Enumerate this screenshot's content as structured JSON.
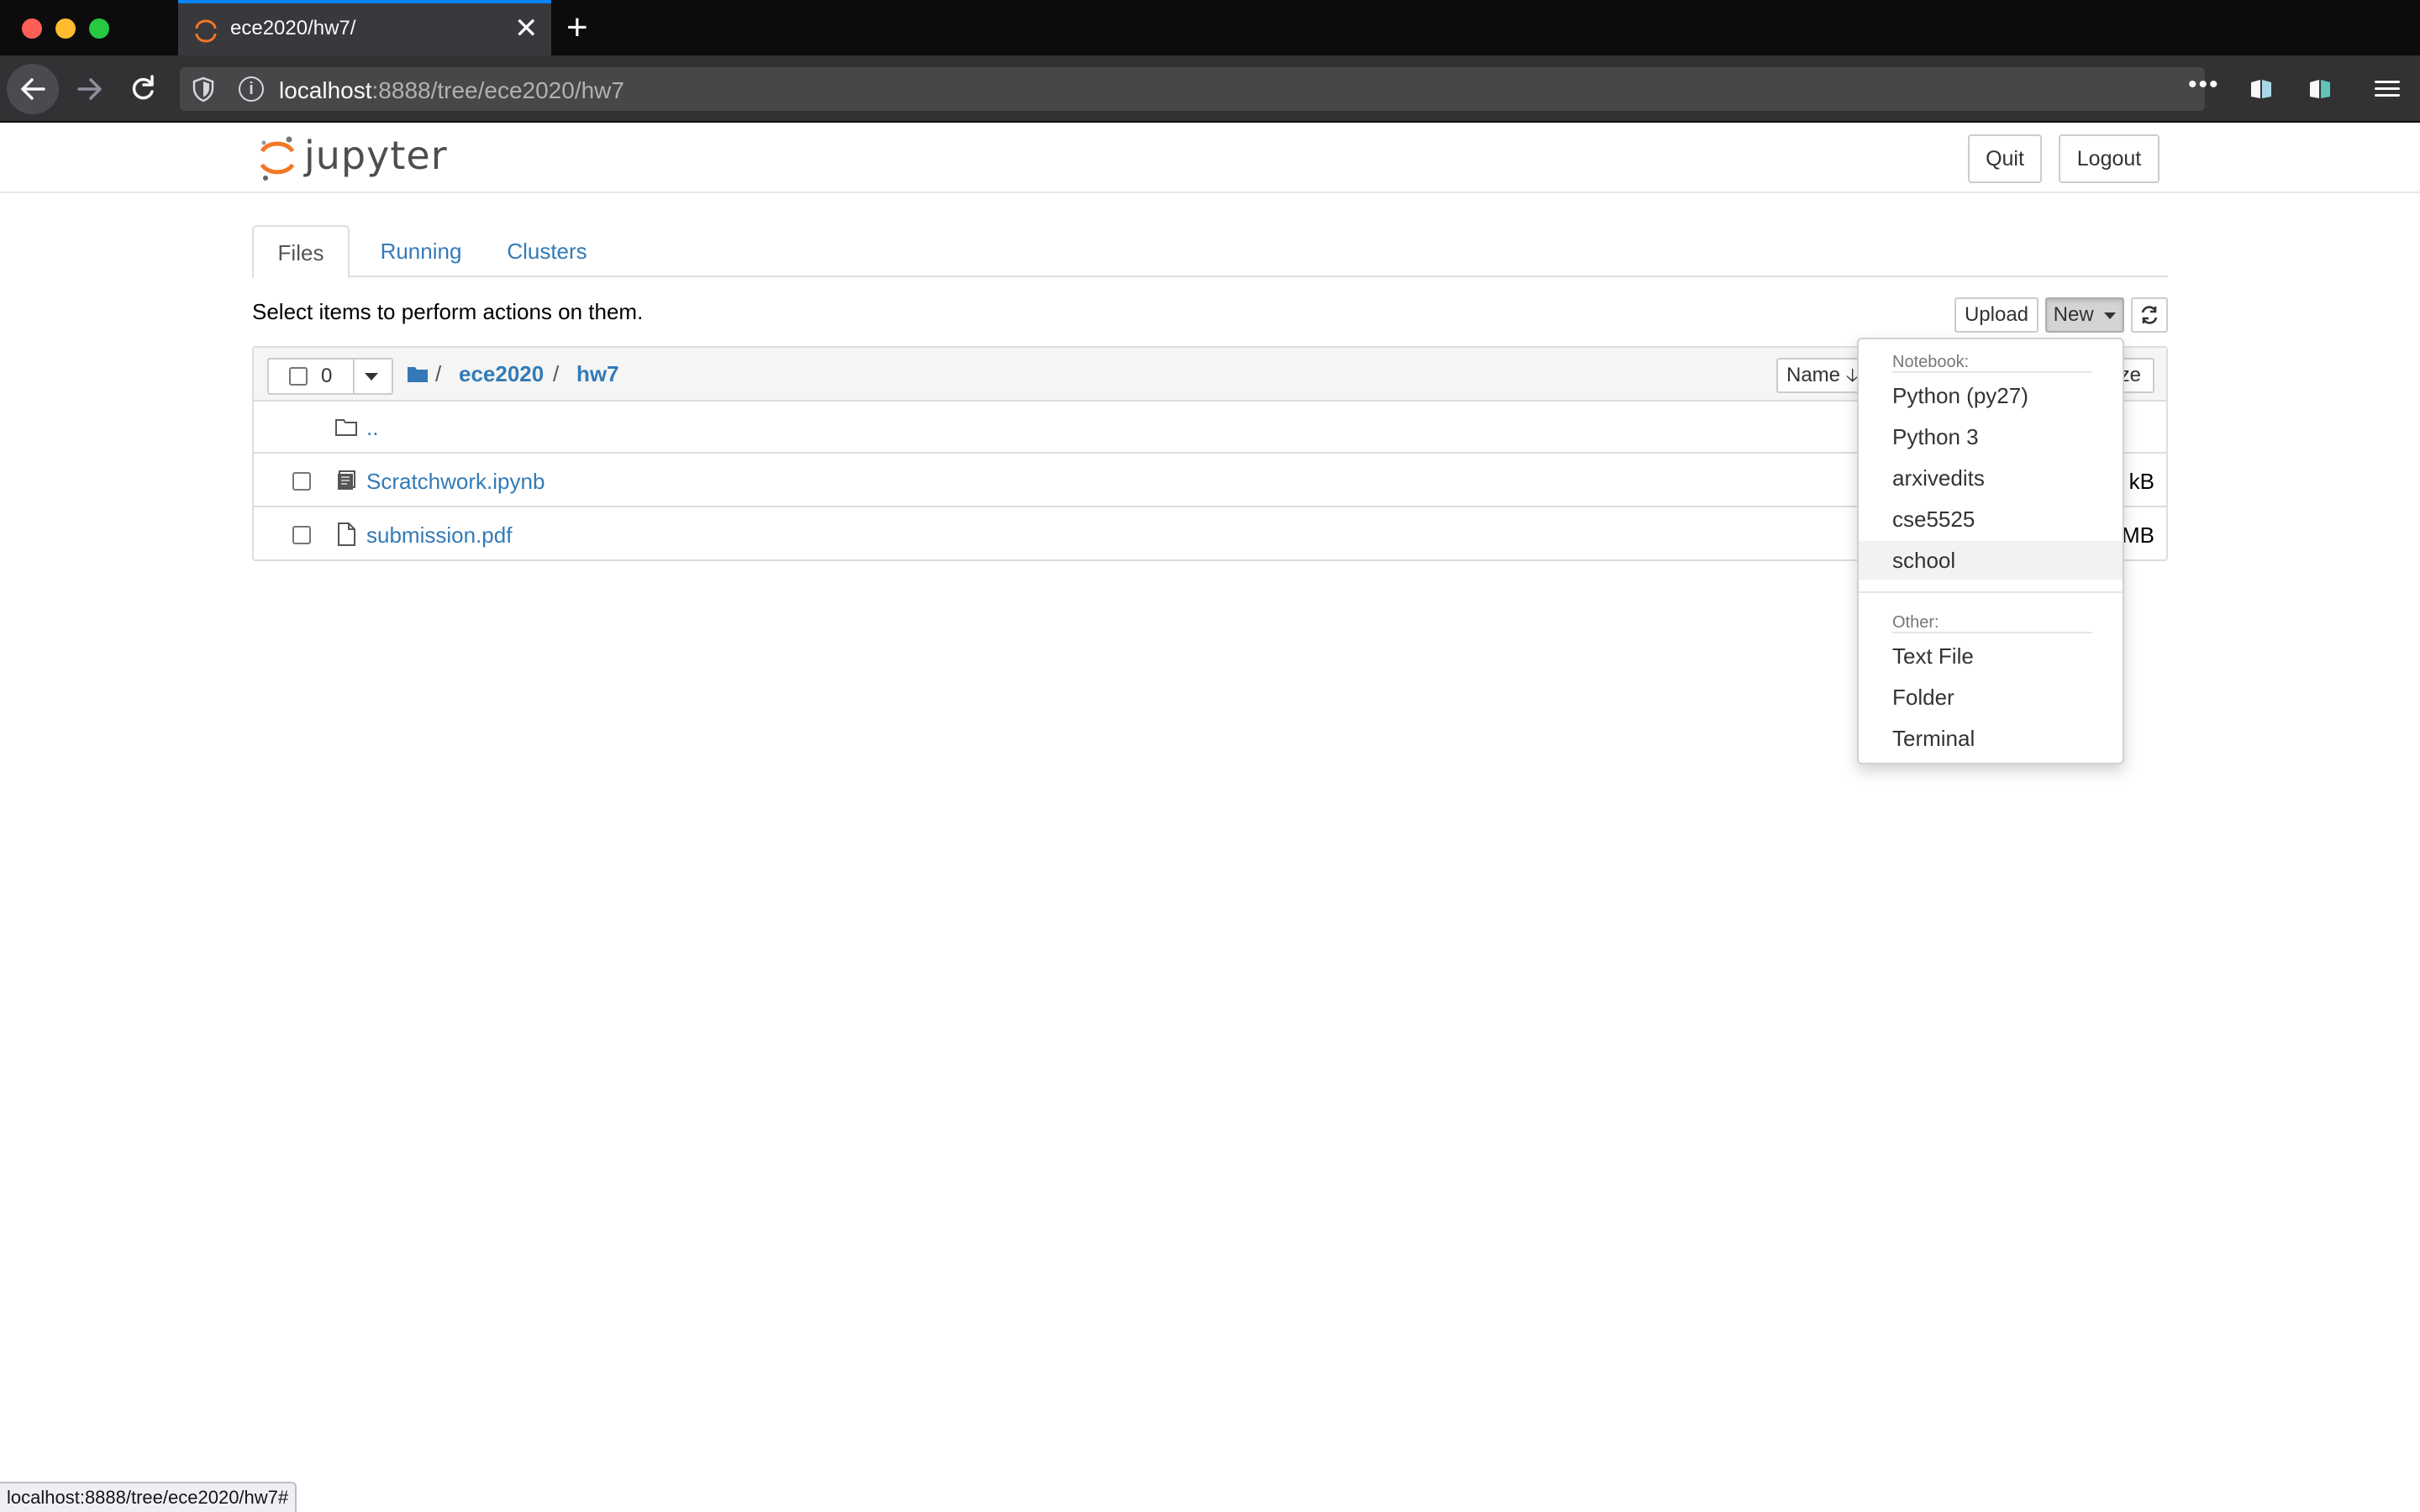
{
  "browser": {
    "tab_title": "ece2020/hw7/",
    "new_tab_label": "+",
    "tab_close_label": "✕",
    "url_host": "localhost",
    "url_rest": ":8888/tree/ece2020/hw7",
    "url_more": "•••",
    "status_url": "localhost:8888/tree/ece2020/hw7#",
    "icons": [
      "back-arrow-icon",
      "forward-arrow-icon",
      "reload-icon",
      "shield-icon",
      "info-icon",
      "pocket-icon",
      "extension-icon",
      "hamburger-menu-icon"
    ]
  },
  "header": {
    "wordmark": "jupyter",
    "quit_label": "Quit",
    "logout_label": "Logout",
    "logo_color": "#f37726"
  },
  "tabs": [
    {
      "label": "Files",
      "active": true
    },
    {
      "label": "Running",
      "active": false
    },
    {
      "label": "Clusters",
      "active": false
    }
  ],
  "toolbar": {
    "hint": "Select items to perform actions on them.",
    "upload_label": "Upload",
    "new_label": "New",
    "refresh_icon": "refresh-icon"
  },
  "file_list": {
    "selected_count": "0",
    "breadcrumb": [
      "ece2020",
      "hw7"
    ],
    "breadcrumb_sep": "/",
    "sort_name_label": "Name",
    "sort_name_arrow": "🡣",
    "sort_size_label": "ze",
    "parent_label": "..",
    "items": [
      {
        "name": "Scratchwork.ipynb",
        "type": "notebook",
        "size_visible": "kB"
      },
      {
        "name": "submission.pdf",
        "type": "file",
        "size_visible": "MB"
      }
    ]
  },
  "new_menu": {
    "notebook_header": "Notebook:",
    "notebook_items": [
      "Python (py27)",
      "Python 3",
      "arxivedits",
      "cse5525",
      "school"
    ],
    "highlighted": "school",
    "other_header": "Other:",
    "other_items": [
      "Text File",
      "Folder",
      "Terminal"
    ]
  },
  "colors": {
    "link": "#337ab7",
    "accent_tab": "#0a84ff",
    "chrome_dark": "#0c0c0d"
  }
}
